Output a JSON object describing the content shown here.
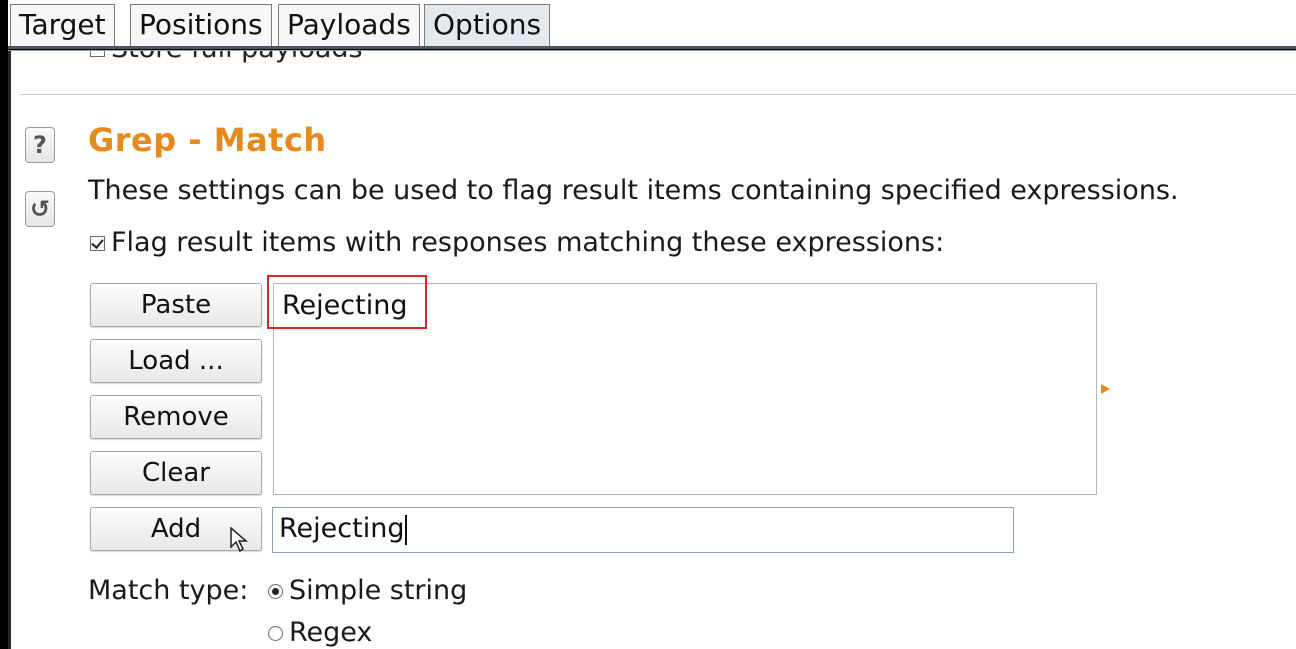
{
  "tabs": [
    {
      "label": "Target",
      "active": false
    },
    {
      "label": "Positions",
      "active": false
    },
    {
      "label": "Payloads",
      "active": false
    },
    {
      "label": "Options",
      "active": true
    }
  ],
  "store_full_payloads": {
    "label": "Store full payloads",
    "checked": false
  },
  "side_icons": {
    "help": "?",
    "reset": "↺"
  },
  "grep_match": {
    "title": "Grep - Match",
    "description": "These settings can be used to flag result items containing specified expressions.",
    "flag_checkbox": {
      "label": "Flag result items with responses matching these expressions:",
      "checked": true
    },
    "buttons": {
      "paste": "Paste",
      "load": "Load ...",
      "remove": "Remove",
      "clear": "Clear",
      "add": "Add"
    },
    "list_items": [
      "Rejecting"
    ],
    "add_input_value": "Rejecting",
    "match_type": {
      "label": "Match type:",
      "options": [
        {
          "label": "Simple string",
          "selected": true
        },
        {
          "label": "Regex",
          "selected": false
        }
      ]
    }
  },
  "colors": {
    "heading": "#e58a1f",
    "highlight": "#d42a2a"
  }
}
